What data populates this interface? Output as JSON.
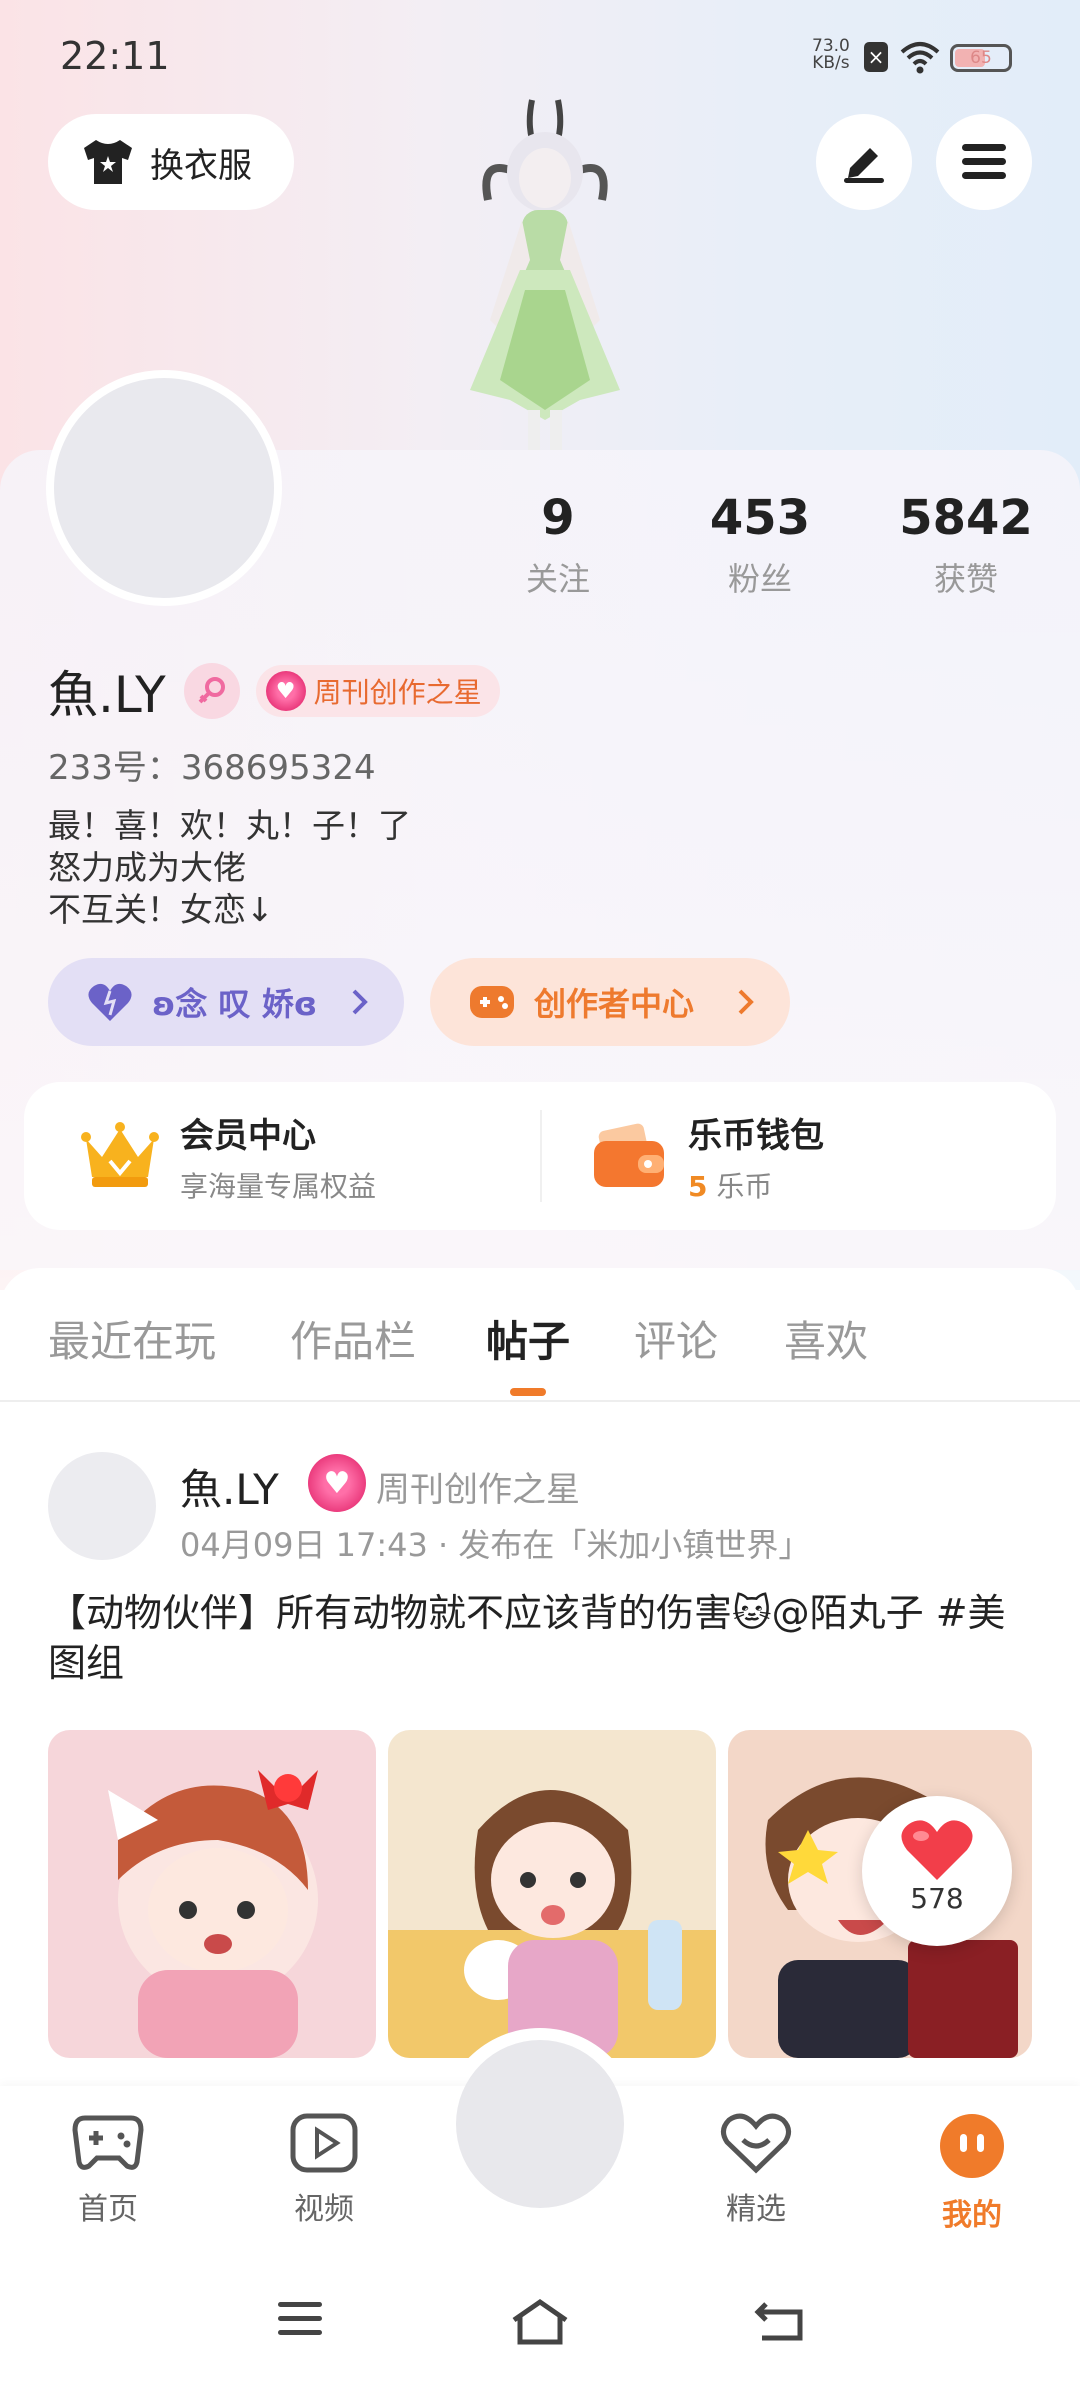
{
  "status": {
    "time": "22:11",
    "net_speed": "73.0",
    "net_unit": "KB/s",
    "battery": "65"
  },
  "header": {
    "dress_label": "换衣服",
    "edit_icon": "pen-icon",
    "menu_icon": "menu-icon"
  },
  "stats": [
    {
      "num": "9",
      "label": "关注"
    },
    {
      "num": "453",
      "label": "粉丝"
    },
    {
      "num": "5842",
      "label": "获赞"
    }
  ],
  "profile": {
    "name": "魚.LY",
    "badge": "周刊创作之星",
    "uid": "233号：368695324",
    "bio": [
      "最！喜！欢！丸！子！了",
      "怒力成为大佬",
      "不互关！女恋↓"
    ]
  },
  "pills": {
    "couple": "ʚ念 叹 娇ɞ",
    "creator": "创作者中心"
  },
  "wallet": {
    "vip_title": "会员中心",
    "vip_sub": "享海量专属权益",
    "coin_title": "乐币钱包",
    "coin_value": "5",
    "coin_unit": "乐币"
  },
  "tabs": [
    "最近在玩",
    "作品栏",
    "帖子",
    "评论",
    "喜欢"
  ],
  "active_tab": "帖子",
  "post": {
    "author": "魚.LY",
    "author_badge": "周刊创作之星",
    "meta": "04月09日 17:43 · 发布在「米加小镇世界」",
    "text": "【动物伙伴】所有动物就不应该背的伤害🐱@陌丸子 #美图组",
    "likes": "578"
  },
  "bottom_nav": [
    "首页",
    "视频",
    "精选",
    "我的"
  ],
  "colors": {
    "accent": "#f07b2a",
    "purple": "#6b62c8"
  }
}
